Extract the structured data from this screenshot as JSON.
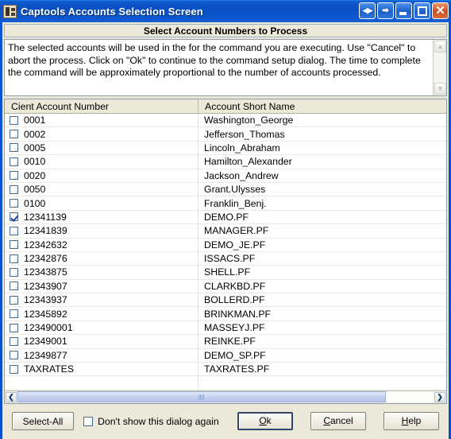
{
  "window": {
    "title": "Captools Accounts Selection Screen",
    "app_icon": "captools-app-icon",
    "titlebar_buttons": [
      {
        "name": "resize-horizontal-button",
        "glyph": "◀▶"
      },
      {
        "name": "restore-window-button",
        "glyph": "⬚"
      },
      {
        "name": "minimize-button",
        "glyph": "_"
      },
      {
        "name": "maximize-button",
        "glyph": "□"
      },
      {
        "name": "close-button",
        "glyph": "✕"
      }
    ]
  },
  "banner": {
    "title": "Select Account Numbers to Process"
  },
  "instructions": {
    "text": "The selected accounts will be used in the for the command you are executing.  Use \"Cancel\" to abort the process. Click on \"Ok\" to continue to the command setup dialog.  The time to complete the command will be approximately proportional to the number of accounts processed.",
    "scroll_up_icon": "chevron-up-icon",
    "scroll_down_icon": "chevron-down-icon"
  },
  "table": {
    "columns": [
      "Cient Account Number",
      "Account Short Name"
    ],
    "rows": [
      {
        "checked": false,
        "account": "0001",
        "short_name": "Washington_George"
      },
      {
        "checked": false,
        "account": "0002",
        "short_name": "Jefferson_Thomas"
      },
      {
        "checked": false,
        "account": "0005",
        "short_name": "Lincoln_Abraham"
      },
      {
        "checked": false,
        "account": "0010",
        "short_name": "Hamilton_Alexander"
      },
      {
        "checked": false,
        "account": "0020",
        "short_name": "Jackson_Andrew"
      },
      {
        "checked": false,
        "account": "0050",
        "short_name": "Grant.Ulysses"
      },
      {
        "checked": false,
        "account": "0100",
        "short_name": "Franklin_Benj."
      },
      {
        "checked": true,
        "account": "12341139",
        "short_name": "DEMO.PF"
      },
      {
        "checked": false,
        "account": "12341839",
        "short_name": "MANAGER.PF"
      },
      {
        "checked": false,
        "account": "12342632",
        "short_name": "DEMO_JE.PF"
      },
      {
        "checked": false,
        "account": "12342876",
        "short_name": "ISSACS.PF"
      },
      {
        "checked": false,
        "account": "12343875",
        "short_name": "SHELL.PF"
      },
      {
        "checked": false,
        "account": "12343907",
        "short_name": "CLARKBD.PF"
      },
      {
        "checked": false,
        "account": "12343937",
        "short_name": "BOLLERD.PF"
      },
      {
        "checked": false,
        "account": "12345892",
        "short_name": "BRINKMAN.PF"
      },
      {
        "checked": false,
        "account": "123490001",
        "short_name": "MASSEYJ.PF"
      },
      {
        "checked": false,
        "account": "12349001",
        "short_name": "REINKE.PF"
      },
      {
        "checked": false,
        "account": "12349877",
        "short_name": "DEMO_SP.PF"
      },
      {
        "checked": false,
        "account": "TAXRATES",
        "short_name": "TAXRATES.PF"
      },
      {
        "checked": null,
        "account": "",
        "short_name": ""
      }
    ]
  },
  "hscrollbar": {
    "left_arrow_icon": "chevron-left-icon",
    "right_arrow_icon": "chevron-right-icon"
  },
  "footer": {
    "select_all_label": "Select-All",
    "dont_show_label": "Don't show this dialog again",
    "dont_show_checked": false,
    "ok_label": "Ok",
    "cancel_label": "Cancel",
    "help_label": "Help"
  },
  "colors": {
    "titlebar_blue": "#0a4fc4",
    "face": "#ece9d8",
    "close_orange": "#cb5226",
    "check_blue": "#27409a",
    "scroll_thumb": "#c3d0ef"
  }
}
